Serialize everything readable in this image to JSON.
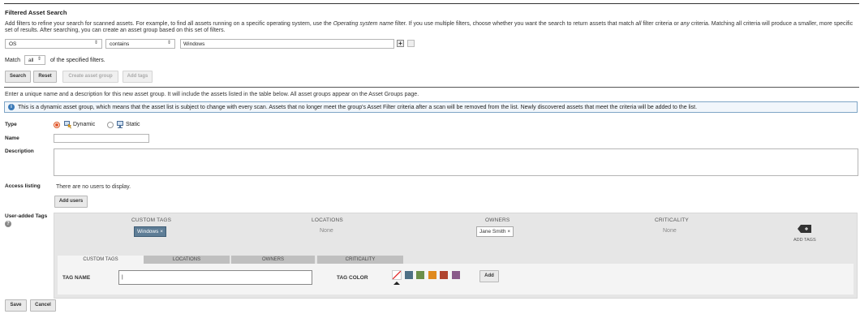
{
  "panel": {
    "title": "Filtered Asset Search",
    "intro_a": "Add filters to refine your search for scanned assets. For example, to find all assets running on a specific operating system, use the ",
    "intro_em1": "Operating system name",
    "intro_b": " filter. If you use multiple filters, choose whether you want the search to return assets that match ",
    "intro_em2": "all",
    "intro_c": " filter criteria or ",
    "intro_em3": "any",
    "intro_d": " criteria. Matching all criteria will produce a smaller, more specific set of results. After searching, you can create an asset group based on this set of filters."
  },
  "filter": {
    "field": "OS",
    "operator": "contains",
    "value": "Windows",
    "plus": "+"
  },
  "match": {
    "label": "Match",
    "value": "all",
    "suffix": "of the specified filters."
  },
  "buttons": {
    "search": "Search",
    "reset": "Reset",
    "create_group": "Create asset group",
    "add_tags": "Add tags"
  },
  "group_intro": "Enter a unique name and a description for this new asset group. It will include the assets listed in the table below. All asset groups appear on the Asset Groups page.",
  "info_banner": "This is a dynamic asset group, which means that the asset list is subject to change with every scan. Assets that no longer meet the group's Asset Filter criteria after a scan will be removed from the list. Newly discovered assets that meet the criteria will be added to the list.",
  "info_icon": "i",
  "form": {
    "type_label": "Type",
    "type_dynamic": "Dynamic",
    "type_static": "Static",
    "name_label": "Name",
    "name_value": "",
    "description_label": "Description",
    "description_value": "",
    "access_label": "Access listing",
    "access_empty": "There are no users to display.",
    "add_users": "Add users",
    "tags_label": "User-added Tags",
    "tags_help": "?"
  },
  "tag_columns": {
    "custom_tags": "CUSTOM TAGS",
    "locations": "LOCATIONS",
    "owners": "OWNERS",
    "criticality": "CRITICALITY",
    "custom_chip": "Windows",
    "locations_value": "None",
    "owner_chip": "Jane Smith",
    "criticality_value": "None",
    "chip_remove": "×",
    "add_tags": "ADD TAGS"
  },
  "tag_tabs": [
    "CUSTOM TAGS",
    "LOCATIONS",
    "OWNERS",
    "CRITICALITY"
  ],
  "tag_form": {
    "name_label": "TAG NAME",
    "name_value": "",
    "color_label": "TAG COLOR",
    "colors": [
      "#4d6f85",
      "#6b8f4a",
      "#e08a1e",
      "#b0442f",
      "#8a5a8a"
    ],
    "add": "Add"
  },
  "footer": {
    "save": "Save",
    "cancel": "Cancel"
  }
}
